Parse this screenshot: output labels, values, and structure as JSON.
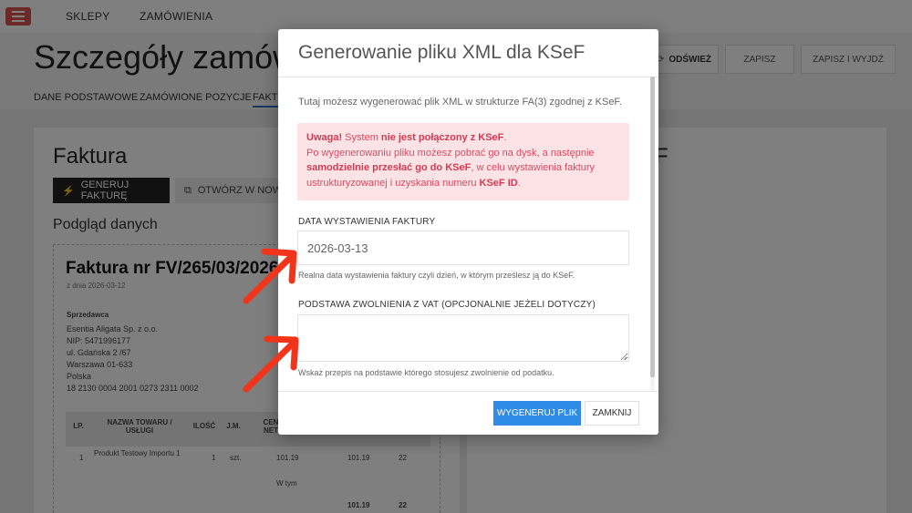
{
  "topbar": {
    "nav": [
      "SKLEPY",
      "ZAMÓWIENIA"
    ]
  },
  "page": {
    "title": "Szczegóły zamów",
    "header_buttons": {
      "refresh": "ODŚWIEŻ",
      "save": "ZAPISZ",
      "save_exit": "ZAPISZ I WYJDŹ"
    },
    "subnav": [
      "DANE PODSTAWOWE",
      "ZAMÓWIONE POZYCJE",
      "FAKTU"
    ]
  },
  "invoice_card": {
    "heading": "Faktura",
    "generate_button": "GENERUJ FAKTURĘ",
    "open_button": "OTWÓRZ W NOWY",
    "preview_heading": "Podgląd danych",
    "right_fragment": "F"
  },
  "invoice_doc": {
    "title": "Faktura nr FV/265/03/2026",
    "date_line": "z dnia 2026-03-12",
    "seller_label": "Sprzedawca",
    "seller_lines": [
      "Esentia Aligata Sp. z o.o.",
      "NIP: 5471996177",
      "ul. Gdańska 2 /67",
      "Warszawa 01-633",
      "Polska",
      "18 2130 0004 2001 0273 2311 0002"
    ],
    "table_headers": [
      "LP.",
      "NAZWA TOWARU / USŁUGI",
      "ILOŚĆ",
      "J.M.",
      "CEN NET"
    ],
    "row": {
      "lp": "1",
      "name": "Produkt Testowy Importu 1",
      "qty": "1",
      "unit": "szt.",
      "price": "101.19",
      "net": "101.19",
      "vat": "22"
    },
    "w_tym": "W tym",
    "sum_net": "101.19",
    "sum_vat": "22"
  },
  "modal": {
    "title": "Generowanie pliku XML dla KSeF",
    "intro": "Tutaj możesz wygenerować plik XML w strukturze FA(3) zgodnej z KSeF.",
    "alert": {
      "l1_a": "Uwaga!",
      "l1_b": " System ",
      "l1_c": "nie jest połączony z KSeF",
      "l1_d": ".",
      "l2": "Po wygenerowaniu pliku możesz pobrać go na dysk, a następnie",
      "l3_a": "samodzielnie przesłać go do KSeF",
      "l3_b": ", w celu wystawienia faktury",
      "l4_a": "ustrukturyzowanej i uzyskania numeru ",
      "l4_b": "KSeF ID",
      "l4_c": "."
    },
    "date_label": "DATA WYSTAWIENIA FAKTURY",
    "date_value": "2026-03-13",
    "date_help": "Realna data wystawienia faktury czyli dzień, w którym prześlesz ją do KSeF.",
    "vat_label": "PODSTAWA ZWOLNIENIA Z VAT (OPCJONALNIE JEŻELI DOTYCZY)",
    "vat_value": "",
    "vat_help": "Wskaż przepis na podstawie którego stosujesz zwolnienie od podatku.",
    "btn_generate": "WYGENERUJ PLIK",
    "btn_close": "ZAMKNIJ"
  },
  "colors": {
    "accent_blue": "#2f8be6",
    "alert_bg": "#fde3e6",
    "alert_text": "#e0475d",
    "arrow_red": "#f2341b",
    "menu_red": "#d9534f"
  },
  "icons": [
    "menu-icon",
    "refresh-icon",
    "bolt-icon",
    "external-link-icon",
    "resize-grip-icon"
  ]
}
